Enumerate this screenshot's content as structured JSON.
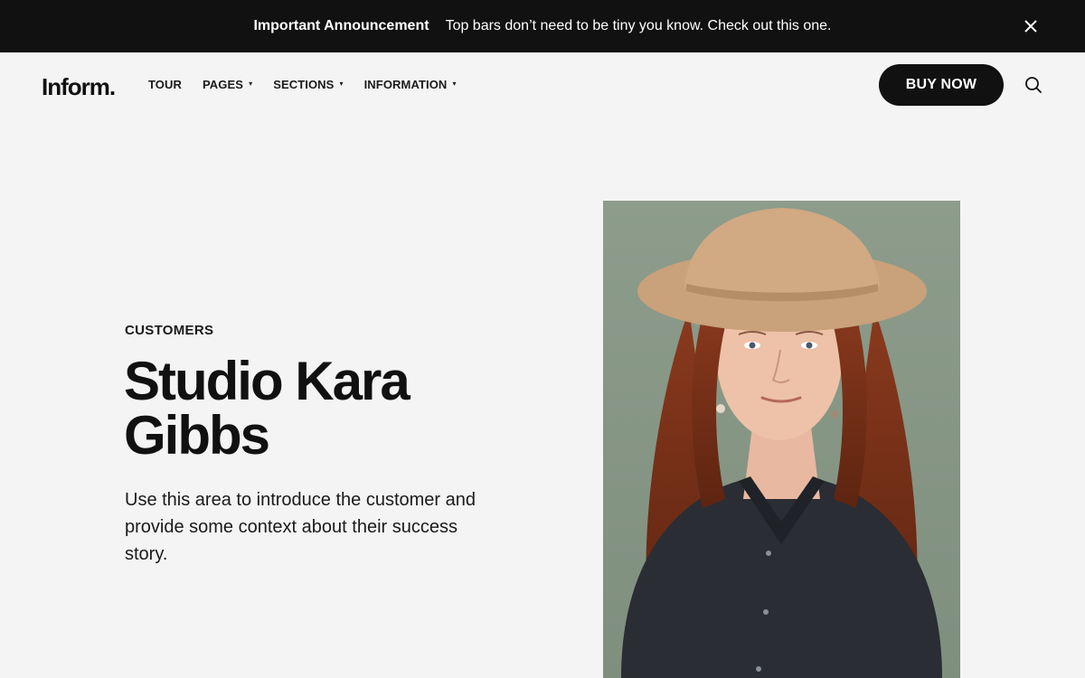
{
  "announcement": {
    "title": "Important Announcement",
    "text": "Top bars don’t need to be tiny you know. Check out this one.",
    "close_icon": "close-icon"
  },
  "header": {
    "logo": "Inform.",
    "nav": [
      {
        "label": "TOUR",
        "has_dropdown": false
      },
      {
        "label": "PAGES",
        "has_dropdown": true
      },
      {
        "label": "SECTIONS",
        "has_dropdown": true
      },
      {
        "label": "INFORMATION",
        "has_dropdown": true
      }
    ],
    "caret": "▾",
    "buy_label": "BUY NOW",
    "search_icon": "search-icon"
  },
  "hero": {
    "eyebrow": "CUSTOMERS",
    "title": "Studio Kara Gibbs",
    "description": "Use this area to introduce the customer and provide some context about their success story."
  },
  "portrait": {
    "subject": "woman-with-hat-portrait"
  },
  "colors": {
    "bar_bg": "#111111",
    "page_bg": "#f4f4f4",
    "button_bg": "#111111",
    "button_text": "#ffffff"
  }
}
